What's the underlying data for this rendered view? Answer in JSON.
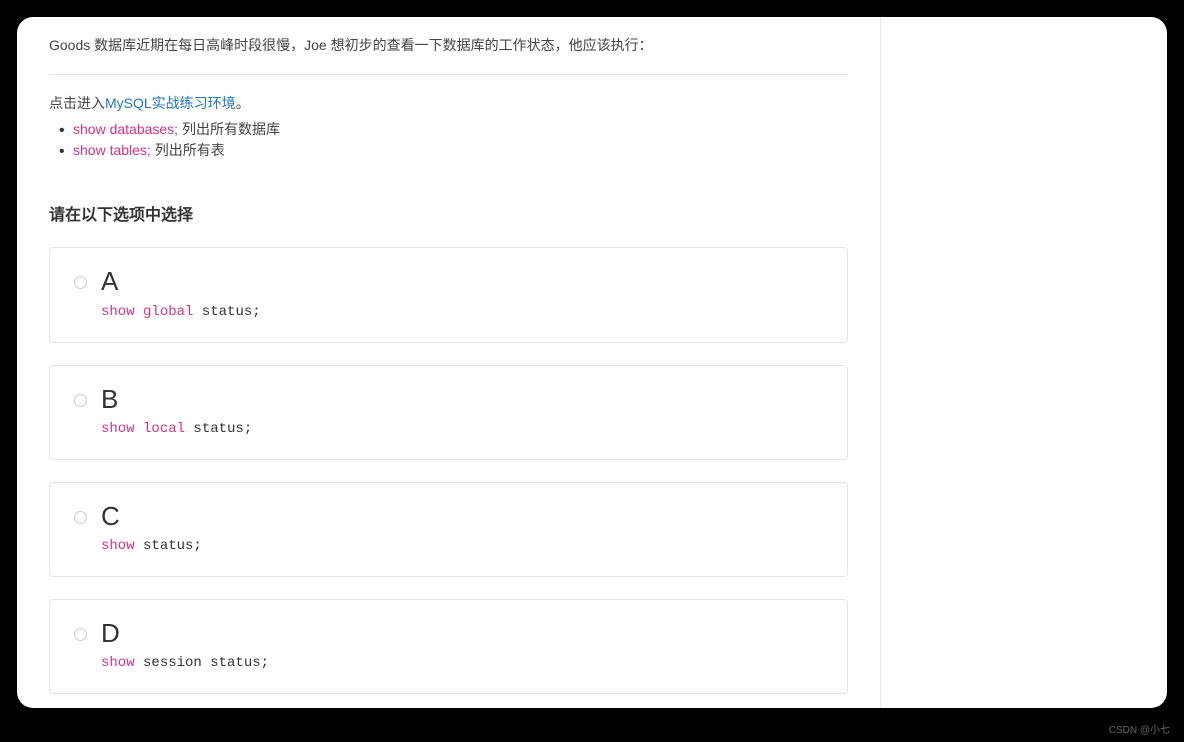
{
  "question": "Goods 数据库近期在每日高峰时段很慢，Joe 想初步的查看一下数据库的工作状态，他应该执行：",
  "intro": {
    "prefix": "点击进入",
    "link": "MySQL实战练习环境",
    "suffix": "。"
  },
  "commands": [
    {
      "code": "show databases;",
      "desc": " 列出所有数据库"
    },
    {
      "code": "show tables;",
      "desc": " 列出所有表"
    }
  ],
  "optionsHeading": "请在以下选项中选择",
  "options": [
    {
      "letter": "A",
      "tokens": [
        {
          "t": "show",
          "k": true
        },
        {
          "t": " ",
          "k": false
        },
        {
          "t": "global",
          "k": true
        },
        {
          "t": " status;",
          "k": false
        }
      ]
    },
    {
      "letter": "B",
      "tokens": [
        {
          "t": "show",
          "k": true
        },
        {
          "t": " ",
          "k": false
        },
        {
          "t": "local",
          "k": true
        },
        {
          "t": " status;",
          "k": false
        }
      ]
    },
    {
      "letter": "C",
      "tokens": [
        {
          "t": "show",
          "k": true
        },
        {
          "t": " status;",
          "k": false
        }
      ]
    },
    {
      "letter": "D",
      "tokens": [
        {
          "t": "show",
          "k": true
        },
        {
          "t": " session status;",
          "k": false
        }
      ]
    }
  ],
  "watermark": "CSDN @小七",
  "sidebar": {}
}
